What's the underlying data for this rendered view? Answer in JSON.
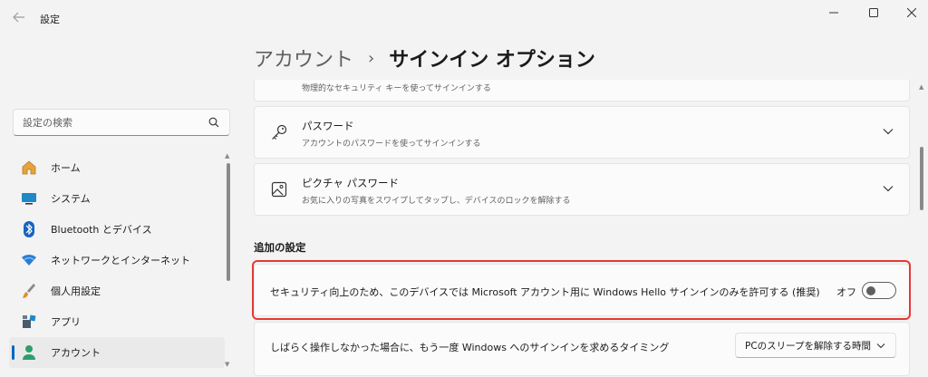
{
  "window": {
    "title": "設定",
    "back_icon": "back-arrow-icon",
    "controls": [
      "minimize",
      "maximize",
      "close"
    ]
  },
  "header": {
    "parent": "アカウント",
    "separator": "›",
    "current": "サインイン オプション"
  },
  "search": {
    "placeholder": "設定の検索",
    "value": ""
  },
  "sidebar": {
    "items": [
      {
        "label": "ホーム",
        "icon": "home-icon"
      },
      {
        "label": "システム",
        "icon": "system-icon"
      },
      {
        "label": "Bluetooth とデバイス",
        "icon": "bluetooth-icon"
      },
      {
        "label": "ネットワークとインターネット",
        "icon": "network-icon"
      },
      {
        "label": "個人用設定",
        "icon": "personalization-icon"
      },
      {
        "label": "アプリ",
        "icon": "apps-icon"
      },
      {
        "label": "アカウント",
        "icon": "account-icon",
        "active": true
      }
    ]
  },
  "content": {
    "partial_card": {
      "subtitle": "物理的なセキュリティ キーを使ってサインインする"
    },
    "password": {
      "title": "パスワード",
      "subtitle": "アカウントのパスワードを使ってサインインする",
      "icon": "key-icon"
    },
    "picture_password": {
      "title": "ピクチャ パスワード",
      "subtitle": "お気に入りの写真をスワイプしてタップし、デバイスのロックを解除する",
      "icon": "picture-icon"
    },
    "additional_settings": {
      "heading": "追加の設定",
      "hello_only": {
        "label": "セキュリティ向上のため、このデバイスでは Microsoft アカウント用に Windows Hello サインインのみを許可する (推奨)",
        "state": "オフ",
        "enabled": false
      },
      "require_signin": {
        "label": "しばらく操作しなかった場合に、もう一度 Windows へのサインインを求めるタイミング",
        "selected": "PCのスリープを解除する時間"
      }
    }
  },
  "colors": {
    "accent": "#0067c0",
    "highlight": "#e53935",
    "background": "#f3f3f3",
    "card": "#fbfbfb"
  }
}
